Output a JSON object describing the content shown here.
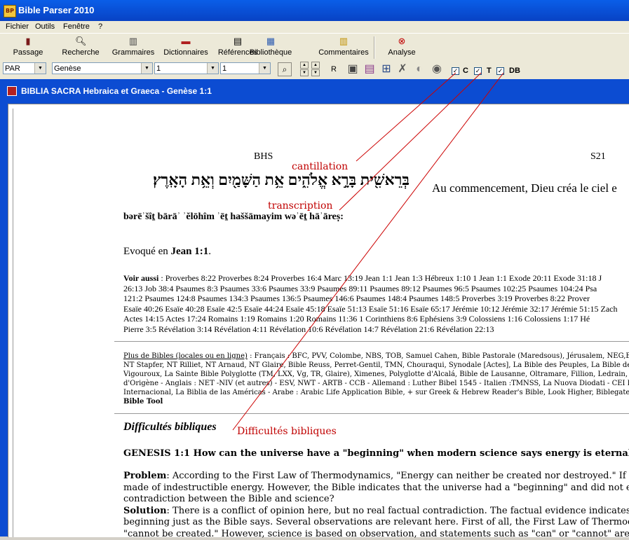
{
  "window": {
    "title": "Bible Parser 2010",
    "app_icon_text": "BP"
  },
  "menu": {
    "items": [
      "Fichier",
      "Outils",
      "Fenêtre",
      "?"
    ]
  },
  "toolbar": {
    "buttons": [
      {
        "label": "Passage",
        "icon": "book-icon"
      },
      {
        "label": "Recherche",
        "icon": "magnifier-icon"
      },
      {
        "label": "Grammaires",
        "icon": "books-icon"
      },
      {
        "label": "Dictionnaires",
        "icon": "dictionary-icon"
      },
      {
        "label": "Références",
        "icon": "document-icon"
      },
      {
        "label": "Bibliothèque",
        "icon": "library-icon"
      },
      {
        "label": "Commentaires",
        "icon": "comment-books-icon"
      },
      {
        "label": "Analyse",
        "icon": "analysis-icon"
      }
    ]
  },
  "controls": {
    "mode": "PAR",
    "book": "Genèse",
    "chapter": "1",
    "verse": "1",
    "r_label": "R",
    "check_c": "C",
    "check_t": "T",
    "check_db": "DB"
  },
  "child": {
    "title": "BIBLIA SACRA Hebraica et Graeca - Genèse 1:1"
  },
  "content": {
    "bhs": "BHS",
    "s21": "S21",
    "hebrew": "בְּרֵאשִׁ֖ית בָּרָ֣א אֱלֹהִ֑ים אֵ֥ת הַשָּׁמַ֖יִם וְאֵ֥ת הָאָֽרֶץ׃",
    "french": "Au commencement, Dieu créa le ciel e",
    "transcription": "bərēʾšîṯ bārāʾ ʾĕlōhîm ʾēṯ haššāmayim wəʾēṯ hāʾāreṣ:",
    "evoque_prefix": "Evoqué en ",
    "evoque_ref": "Jean 1:1",
    "evoque_suffix": ".",
    "voir_label": "Voir aussi",
    "voir_lines": [
      " : Proverbes 8:22 Proverbes 8:24 Proverbes 16:4 Marc 13:19 Jean 1:1 Jean 1:3 Hébreux 1:10 1 Jean 1:1 Exode 20:11 Exode 31:18 J",
      "26:13 Job 38:4 Psaumes 8:3 Psaumes 33:6 Psaumes 33:9 Psaumes 89:11 Psaumes 89:12 Psaumes 96:5 Psaumes 102:25 Psaumes 104:24 Psa",
      "121:2 Psaumes 124:8 Psaumes 134:3 Psaumes 136:5 Psaumes 146:6 Psaumes 148:4 Psaumes 148:5 Proverbes 3:19 Proverbes 8:22 Prover",
      "Esaïe 40:26 Esaïe 40:28 Esaïe 42:5 Esaïe 44:24 Esaïe 45:18 Esaïe 51:13 Esaïe 51:16 Esaïe 65:17 Jérémie 10:12 Jérémie 32:17 Jérémie 51:15 Zach",
      "Actes 14:15 Actes 17:24 Romains 1:19 Romains 1:20 Romains 11:36 1 Corinthiens 8:6 Ephésiens 3:9 Colossiens 1:16 Colossiens 1:17 Hé",
      "Pierre 3:5 Révélation 3:14 Révélation 4:11 Révélation 10:6 Révélation 14:7 Révélation 21:6 Révélation 22:13"
    ],
    "bibles_link": "Plus de Bibles (locales ou en ligne)",
    "bibles_lines": [
      " : Français : BFC, PVV, Colombe, NBS, TOB, Samuel Cahen, Bible Pastorale (Maredsous), Jérusalem, NEG,Boisson, Genoude [",
      "NT Stapfer, NT Rilliet, NT Arnaud, NT Glaire, Bible Reuss, Perret-Gentil, TMN, Chouraqui, Synodale [Actes], La Bible des Peuples, La Bible de Vence (latin/fran",
      "Vigouroux, La Sainte Bible Polyglotte (TM, LXX, Vg, TR, Glaire), Ximenes, Polyglotte d'Alcalá, Bible de Lausanne, Oltramare, Fillion, Ledrain, LSG 1898, Bouss",
      "d'Origène - Anglais : NET -NIV (et autres) - ESV, NWT - ARTB - CCB - Allemand : Luther Bibel 1545 - Italien :TMNSS, La Nuova Diodati - CEI Espagnol",
      "Internacional, La Biblia de las Américas - Arabe : Arabic Life Application Bible, + sur Greek & Hebrew Reader's Bible, Look Higher, Biblegateway , T",
      "Bible Tool"
    ],
    "difficultes_title": "Difficultés bibliques",
    "genesis_heading": "GENESIS 1:1  How can the universe have a \"beginning\" when modern science says energy is eternal?",
    "problem_label": "Problem",
    "problem_lines": [
      ": According to the First Law of Thermodynamics, \"Energy can neither be created nor destroyed.\" If this is so, then the u",
      "made of indestructible energy. However, the Bible indicates that the universe had a \"beginning\" and did not exist before God \"cre",
      "contradiction between the Bible and science?"
    ],
    "solution_label": "Solution",
    "solution_lines": [
      ": There is a conflict of opinion here, but no real factual contradiction. The factual evidence indicates that the universe is",
      "beginning just as the Bible says. Several observations are relevant here. First of all, the First Law of Thermodynamics is often m",
      "\"cannot be created.\" However, science is based on observation, and statements such as \"can\" or \"cannot\" are not based o"
    ]
  },
  "annotations": {
    "cantillation": "cantillation",
    "transcription": "transcription",
    "difficultes": "Difficultés bibliques"
  }
}
